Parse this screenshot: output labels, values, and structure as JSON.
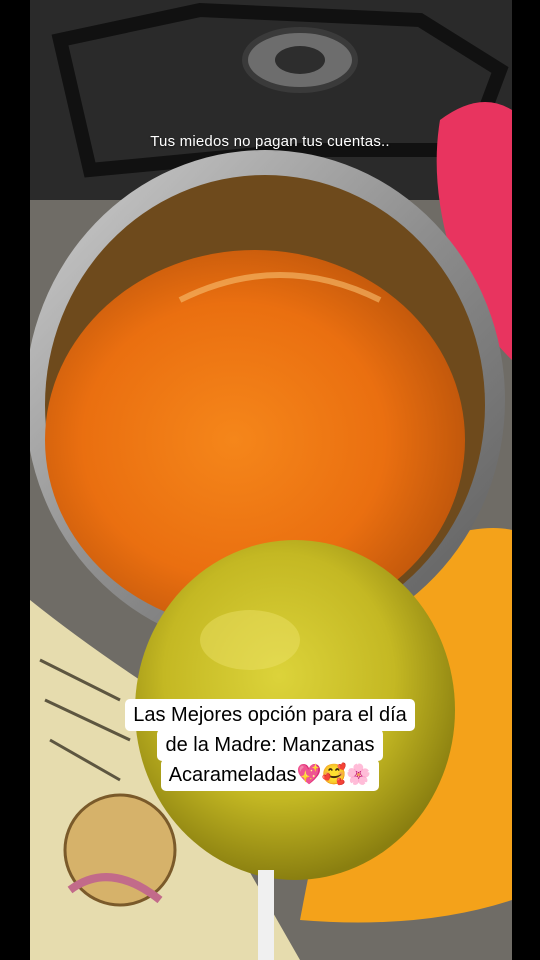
{
  "overlay": {
    "top_caption": "Tus miedos no pagan tus cuentas..",
    "caption_lines": [
      "Las Mejores opción para el día",
      "de la Madre: Manzanas",
      "Acarameladas💖🥰🌸"
    ]
  },
  "colors": {
    "caramel": "#f07a14",
    "apple": "#c9c02a",
    "towel": "#f5a51c",
    "stove": "#1b1b1b",
    "pot": "#b8b8b8"
  },
  "scene_objects": [
    "gas-stove-burner",
    "steel-pot",
    "orange-caramel",
    "green-apple",
    "orange-towel",
    "sugar-cookie-cloth",
    "pink-yarn"
  ]
}
